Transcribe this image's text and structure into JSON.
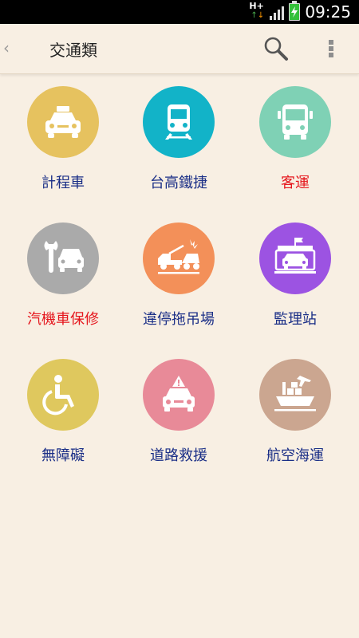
{
  "status_bar": {
    "network": "H+",
    "time": "09:25"
  },
  "action_bar": {
    "back_icon": "chevron-left-icon",
    "title": "交通類",
    "search_icon": "search-icon",
    "overflow_icon": "more-vert-icon"
  },
  "grid": [
    {
      "label": "計程車",
      "icon": "taxi-icon",
      "color": "#e6c25f",
      "label_color": "#1b2f87"
    },
    {
      "label": "台高鐵捷",
      "icon": "train-icon",
      "color": "#12b3c8",
      "label_color": "#1b2f87"
    },
    {
      "label": "客運",
      "icon": "bus-icon",
      "color": "#7fd1b5",
      "label_color": "#e5161d"
    },
    {
      "label": "汽機車保修",
      "icon": "car-repair-icon",
      "color": "#aaaaaa",
      "label_color": "#e5161d"
    },
    {
      "label": "違停拖吊場",
      "icon": "tow-truck-icon",
      "color": "#f39059",
      "label_color": "#1b2f87"
    },
    {
      "label": "監理站",
      "icon": "motor-vehicle-office-icon",
      "color": "#9c53e2",
      "label_color": "#1b2f87"
    },
    {
      "label": "無障礙",
      "icon": "wheelchair-icon",
      "color": "#dfc85e",
      "label_color": "#1b2f87"
    },
    {
      "label": "道路救援",
      "icon": "road-rescue-icon",
      "color": "#e88a98",
      "label_color": "#1b2f87"
    },
    {
      "label": "航空海運",
      "icon": "air-sea-transport-icon",
      "color": "#cba690",
      "label_color": "#1b2f87"
    }
  ]
}
